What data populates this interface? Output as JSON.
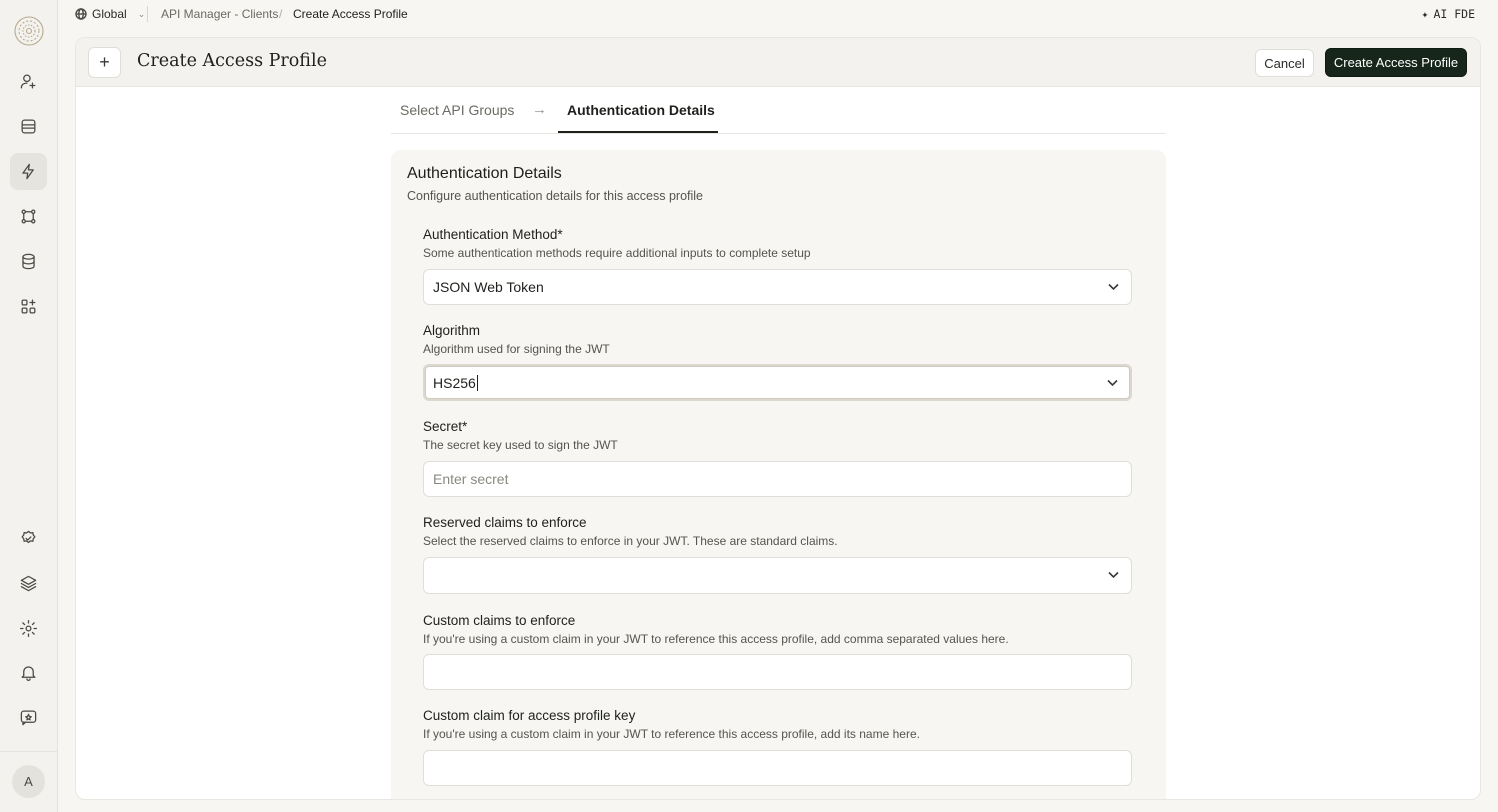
{
  "topbar": {
    "scope": "Global",
    "breadcrumb": [
      "API Manager - Clients",
      "Create Access Profile"
    ],
    "ai_label": "AI FDE"
  },
  "sidebar": {
    "items": [
      {
        "icon": "user-plus-icon"
      },
      {
        "icon": "inbox-icon"
      },
      {
        "icon": "lightning-icon",
        "active": true
      },
      {
        "icon": "nodes-icon"
      },
      {
        "icon": "database-icon"
      },
      {
        "icon": "apps-plus-icon"
      }
    ],
    "bottom_items": [
      {
        "icon": "badge-check-icon"
      },
      {
        "icon": "layers-icon"
      },
      {
        "icon": "gear-icon"
      },
      {
        "icon": "bell-icon"
      },
      {
        "icon": "feedback-icon"
      }
    ],
    "avatar_initial": "A"
  },
  "header": {
    "title": "Create Access Profile",
    "cancel_label": "Cancel",
    "create_label": "Create Access Profile"
  },
  "steps": {
    "step1": "Select API Groups",
    "step2": "Authentication Details"
  },
  "card": {
    "title": "Authentication Details",
    "subtitle": "Configure authentication details for this access profile"
  },
  "fields": {
    "auth_method": {
      "label": "Authentication Method*",
      "help": "Some authentication methods require additional inputs to complete setup",
      "value": "JSON Web Token"
    },
    "algorithm": {
      "label": "Algorithm",
      "help": "Algorithm used for signing the JWT",
      "value": "HS256"
    },
    "secret": {
      "label": "Secret*",
      "help": "The secret key used to sign the JWT",
      "placeholder": "Enter secret"
    },
    "reserved_claims": {
      "label": "Reserved claims to enforce",
      "help": "Select the reserved claims to enforce in your JWT. These are standard claims.",
      "value": ""
    },
    "custom_claims": {
      "label": "Custom claims to enforce",
      "help": "If you're using a custom claim in your JWT to reference this access profile, add comma separated values here.",
      "value": ""
    },
    "custom_claim_key": {
      "label": "Custom claim for access profile key",
      "help": "If you're using a custom claim in your JWT to reference this access profile, add its name here.",
      "value": ""
    }
  },
  "colors": {
    "primary_button": "#17261a",
    "background": "#f7f6f3"
  }
}
